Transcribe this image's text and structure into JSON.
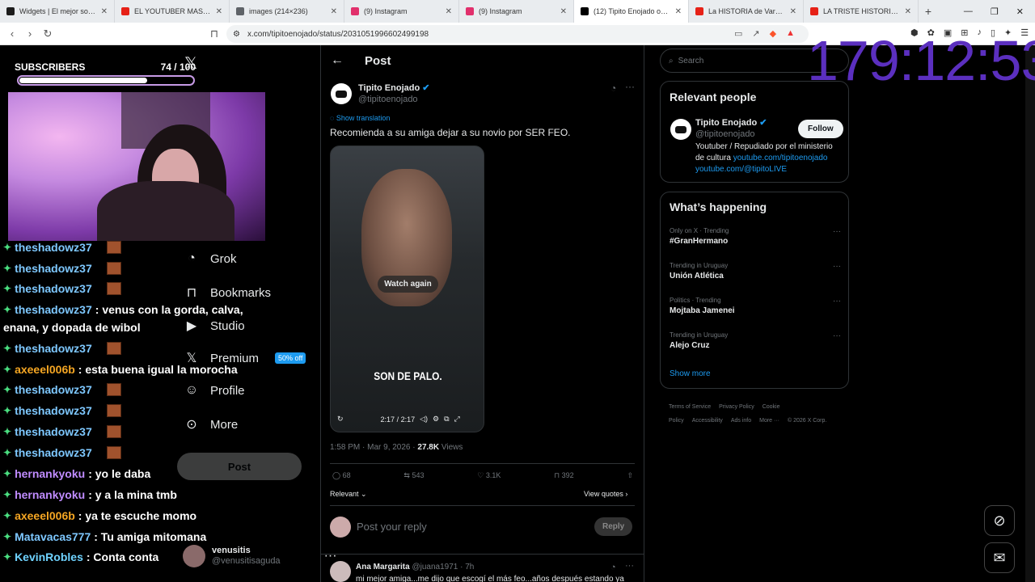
{
  "browser": {
    "tabs": [
      {
        "title": "Widgets | El mejor software para",
        "color": "#1c1c1c",
        "active": false
      },
      {
        "title": "EL YOUTUBER MAS EGOCENTRIC",
        "color": "#e62117",
        "active": false
      },
      {
        "title": "images (214×236)",
        "color": "#5f6368",
        "active": false
      },
      {
        "title": "(9) Instagram",
        "color": "#e1306c",
        "active": false
      },
      {
        "title": "(9) Instagram",
        "color": "#e1306c",
        "active": false
      },
      {
        "title": "(12) Tipito Enojado on X: \"",
        "color": "#000000",
        "active": true
      },
      {
        "title": "La HISTORIA de Vardoc se esta",
        "color": "#e62117",
        "active": false
      },
      {
        "title": "LA TRISTE HISTORIA DE VARDO",
        "color": "#e62117",
        "active": false
      }
    ],
    "url": "x.com/tipitoenojado/status/2031051996602499198"
  },
  "stream": {
    "subscribers_label": "SUBSCRIBERS",
    "subscribers_count": "74  / 100",
    "subscribers_progress": 0.74,
    "timer": "179:12:53"
  },
  "chat": [
    {
      "user": "theshadowz37",
      "msg": "",
      "color": "#7ec8ff",
      "emote": true
    },
    {
      "user": "theshadowz37",
      "msg": "",
      "color": "#7ec8ff",
      "emote": true
    },
    {
      "user": "theshadowz37",
      "msg": "",
      "color": "#7ec8ff",
      "emote": true
    },
    {
      "user": "theshadowz37",
      "msg": " : venus con la gorda, calva,",
      "color": "#7ec8ff",
      "emote": false
    },
    {
      "user": "",
      "msg": "enana, y dopada de wibol",
      "color": "#ffffff",
      "emote": false
    },
    {
      "user": "theshadowz37",
      "msg": "",
      "color": "#7ec8ff",
      "emote": true
    },
    {
      "user": "axeeel006b",
      "msg": " : esta buena igual la morocha",
      "color": "#f5a623",
      "emote": false
    },
    {
      "user": "theshadowz37",
      "msg": "",
      "color": "#7ec8ff",
      "emote": true
    },
    {
      "user": "theshadowz37",
      "msg": "",
      "color": "#7ec8ff",
      "emote": true
    },
    {
      "user": "theshadowz37",
      "msg": "",
      "color": "#7ec8ff",
      "emote": true
    },
    {
      "user": "theshadowz37",
      "msg": "",
      "color": "#7ec8ff",
      "emote": true
    },
    {
      "user": "hernankyoku",
      "msg": " : yo le daba",
      "color": "#c08cff",
      "emote": false
    },
    {
      "user": "hernankyoku",
      "msg": " : y a la mina tmb",
      "color": "#c08cff",
      "emote": false
    },
    {
      "user": "axeeel006b",
      "msg": " : ya te escuche momo",
      "color": "#f5a623",
      "emote": false
    },
    {
      "user": "Matavacas777",
      "msg": " : Tu amiga mitomana",
      "color": "#7ec8ff",
      "emote": false
    },
    {
      "user": "KevinRobles",
      "msg": " : Conta conta",
      "color": "#6fd3ff",
      "emote": false
    }
  ],
  "leftnav": {
    "items": [
      {
        "label": "Grok",
        "icon": "grok-icon"
      },
      {
        "label": "Bookmarks",
        "icon": "bookmark-icon"
      },
      {
        "label": "Studio",
        "icon": "studio-icon"
      },
      {
        "label": "Premium",
        "icon": "x-logo-icon"
      },
      {
        "label": "Profile",
        "icon": "profile-icon"
      },
      {
        "label": "More",
        "icon": "more-icon"
      }
    ],
    "premium_badge": "50% off",
    "post_button": "Post",
    "account_name": "venusitis",
    "account_handle": "@venusitisaguda"
  },
  "post": {
    "header": "Post",
    "author_name": "Tipito Enojado",
    "author_handle": "@tipitoenojado",
    "show_translation": "Show translation",
    "text": "Recomienda a su amiga dejar a su novio por SER FEO.",
    "video_caption": "SON DE PALO.",
    "watch_again": "Watch again",
    "video_time": "2:17 / 2:17",
    "timestamp": "1:58 PM · Mar 9, 2026 · ",
    "views_count": "27.8K",
    "views_label": " Views",
    "replies": "68",
    "reposts": "543",
    "likes": "3.1K",
    "bookmarks": "392",
    "relevant": "Relevant",
    "view_quotes": "View quotes",
    "reply_placeholder": "Post your reply",
    "reply_button": "Reply",
    "reply_author": "Ana Margarita",
    "reply_handle": "@juana1971 · 7h",
    "reply_text": "mi mejor amiga...me dijo que escogí el más feo...años después estando ya"
  },
  "right": {
    "search_placeholder": "Search",
    "relevant_title": "Relevant people",
    "person_name": "Tipito Enojado",
    "person_handle": "@tipitoenojado",
    "follow": "Follow",
    "bio": "Youtuber / Repudiado por el ministerio de cultura ",
    "bio_link1": "youtube.com/tipitoenojado",
    "bio_link2": "youtube.com/@tipitoLIVE",
    "happening_title": "What’s happening",
    "trends": [
      {
        "context": "Only on X · Trending",
        "name": "#GranHermano"
      },
      {
        "context": "Trending in Uruguay",
        "name": "Unión Atlética"
      },
      {
        "context": "Politics · Trending",
        "name": "Mojtaba Jamenei"
      },
      {
        "context": "Trending in Uruguay",
        "name": "Alejo Cruz"
      }
    ],
    "show_more": "Show more",
    "footer": [
      "Terms of Service",
      "Privacy Policy",
      "Cookie Policy",
      "Accessibility",
      "Ads info",
      "More ···",
      "© 2026 X Corp."
    ]
  }
}
